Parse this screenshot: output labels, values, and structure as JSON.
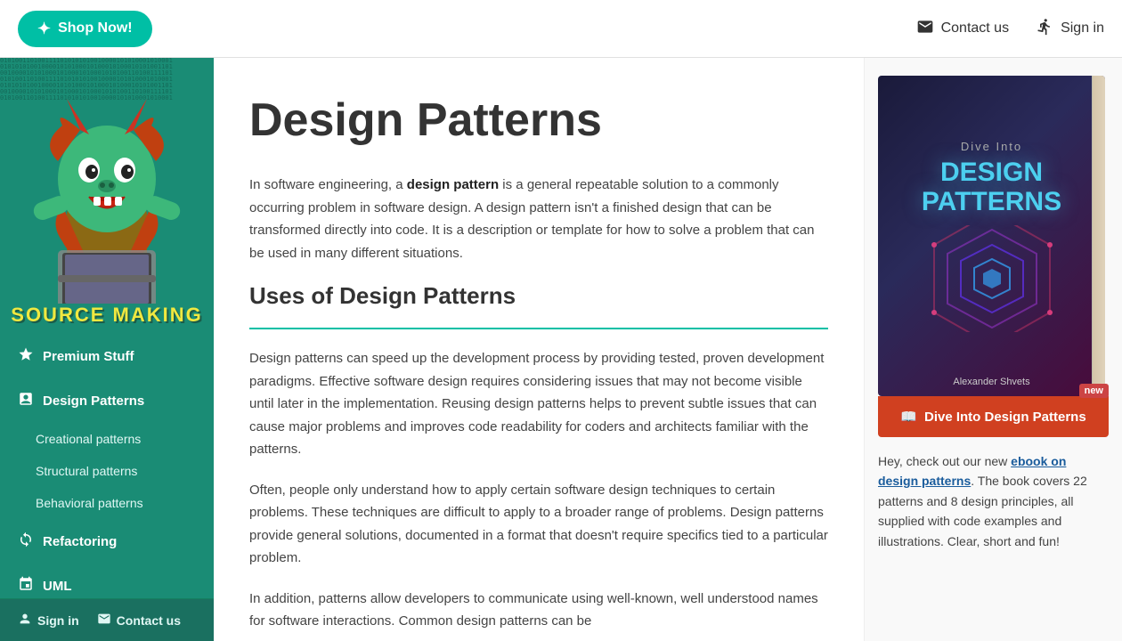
{
  "topnav": {
    "shop_now_label": "Shop Now!",
    "contact_us_label": "Contact us",
    "sign_in_label": "Sign in"
  },
  "sidebar": {
    "source_making_label": "SOURCE MAKING",
    "premium_stuff_label": "Premium Stuff",
    "design_patterns_label": "Design Patterns",
    "creational_patterns_label": "Creational patterns",
    "structural_patterns_label": "Structural patterns",
    "behavioral_patterns_label": "Behavioral patterns",
    "refactoring_label": "Refactoring",
    "uml_label": "UML",
    "footer_sign_in": "Sign in",
    "footer_contact_us": "Contact us"
  },
  "main": {
    "page_title": "Design Patterns",
    "intro_text_1_pre": "In software engineering, a ",
    "intro_bold": "design pattern",
    "intro_text_1_post": " is a general repeatable solution to a commonly occurring problem in software design. A design pattern isn't a finished design that can be transformed directly into code. It is a description or template for how to solve a problem that can be used in many different situations.",
    "section_title": "Uses of Design Patterns",
    "para2": "Design patterns can speed up the development process by providing tested, proven development paradigms. Effective software design requires considering issues that may not become visible until later in the implementation. Reusing design patterns helps to prevent subtle issues that can cause major problems and improves code readability for coders and architects familiar with the patterns.",
    "para3": "Often, people only understand how to apply certain software design techniques to certain problems. These techniques are difficult to apply to a broader range of problems. Design patterns provide general solutions, documented in a format that doesn't require specifics tied to a particular problem.",
    "para4": "In addition, patterns allow developers to communicate using well-known, well understood names for software interactions. Common design patterns can be"
  },
  "book_panel": {
    "dive_into_label": "Dive Into",
    "book_title": "DESIGN PATTERNS",
    "author_label": "Alexander Shvets",
    "cta_label": "Dive Into Design Patterns",
    "new_badge": "new",
    "desc_pre": "Hey, check out our new ",
    "desc_link": "ebook on design patterns",
    "desc_post": ". The book covers 22 patterns and 8 design principles, all supplied with code examples and illustrations. Clear, short and fun!"
  }
}
